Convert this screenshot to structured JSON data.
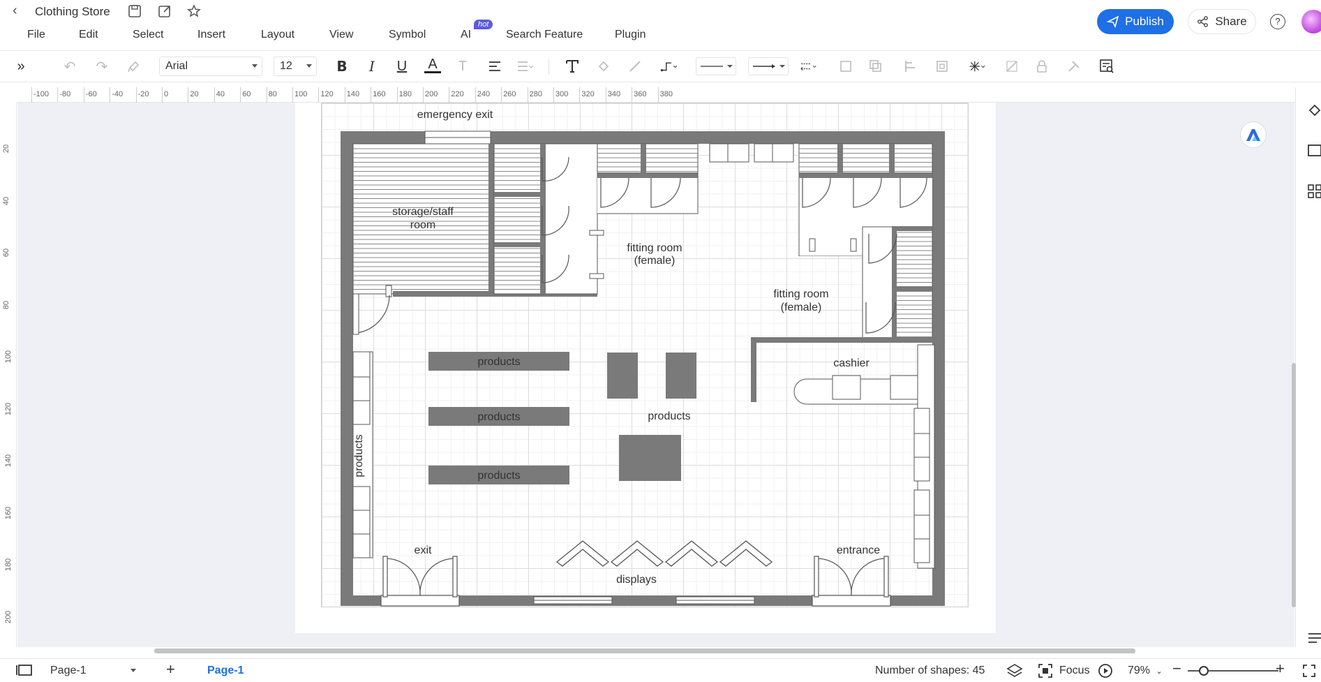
{
  "title": {
    "doc_title": "Clothing Store"
  },
  "header": {
    "publish_label": "Publish",
    "share_label": "Share",
    "help_glyph": "?"
  },
  "menu": {
    "items": [
      "File",
      "Edit",
      "Select",
      "Insert",
      "Layout",
      "View",
      "Symbol",
      "AI",
      "Search Feature",
      "Plugin"
    ],
    "ai_badge": "hot"
  },
  "toolbar": {
    "font": "Arial",
    "size": "12"
  },
  "ruler": {
    "top": [
      "-100",
      "-80",
      "-60",
      "-40",
      "-20",
      "0",
      "20",
      "40",
      "60",
      "80",
      "100",
      "120",
      "140",
      "160",
      "180",
      "200",
      "220",
      "240",
      "260",
      "280",
      "300",
      "320",
      "340",
      "360",
      "380"
    ],
    "left": [
      "20",
      "40",
      "60",
      "80",
      "100",
      "120",
      "140",
      "160",
      "180",
      "200"
    ]
  },
  "floorplan": {
    "labels": {
      "emergency_exit": "emergency exit",
      "storage_line1": "storage/staff",
      "storage_line2": "room",
      "fitting_a_line1": "fitting room",
      "fitting_a_line2": "(female)",
      "fitting_b_line1": "fitting room",
      "fitting_b_line2": "(female)",
      "cashier": "cashier",
      "products_1": "products",
      "products_2": "products",
      "products_3": "products",
      "products_center": "products",
      "products_side": "products",
      "exit": "exit",
      "entrance": "entrance",
      "displays": "displays"
    },
    "wall_color": "#7a7a7a"
  },
  "statusbar": {
    "page_selector": "Page-1",
    "page_tab": "Page-1",
    "shape_count": "Number of shapes: 45",
    "focus_label": "Focus",
    "zoom": "79%"
  },
  "colors": {
    "accent": "#1f6fe5",
    "canvas_bg": "#eef0f5",
    "badge": "#5b5ce0"
  }
}
